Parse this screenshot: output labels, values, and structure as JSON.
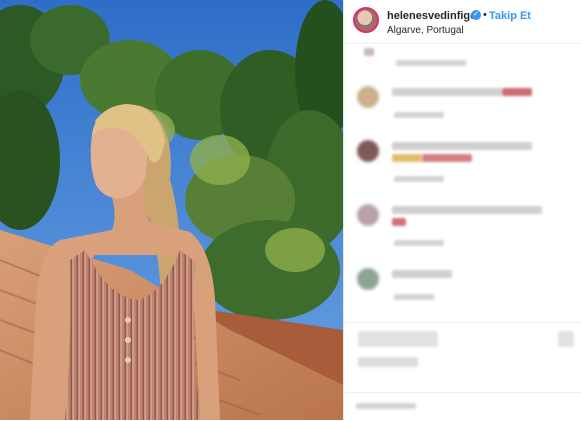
{
  "post": {
    "username": "helenesvedinfigo",
    "verified_glyph": "✓",
    "separator": "•",
    "follow_label": "Takip Et",
    "location": "Algarve, Portugal"
  },
  "icons": {
    "verified": "verified-badge-icon",
    "avatar": "profile-avatar"
  },
  "colors": {
    "link_blue": "#3897f0",
    "text": "#262626",
    "border": "#efefef",
    "sky": "#3f7fd0"
  }
}
